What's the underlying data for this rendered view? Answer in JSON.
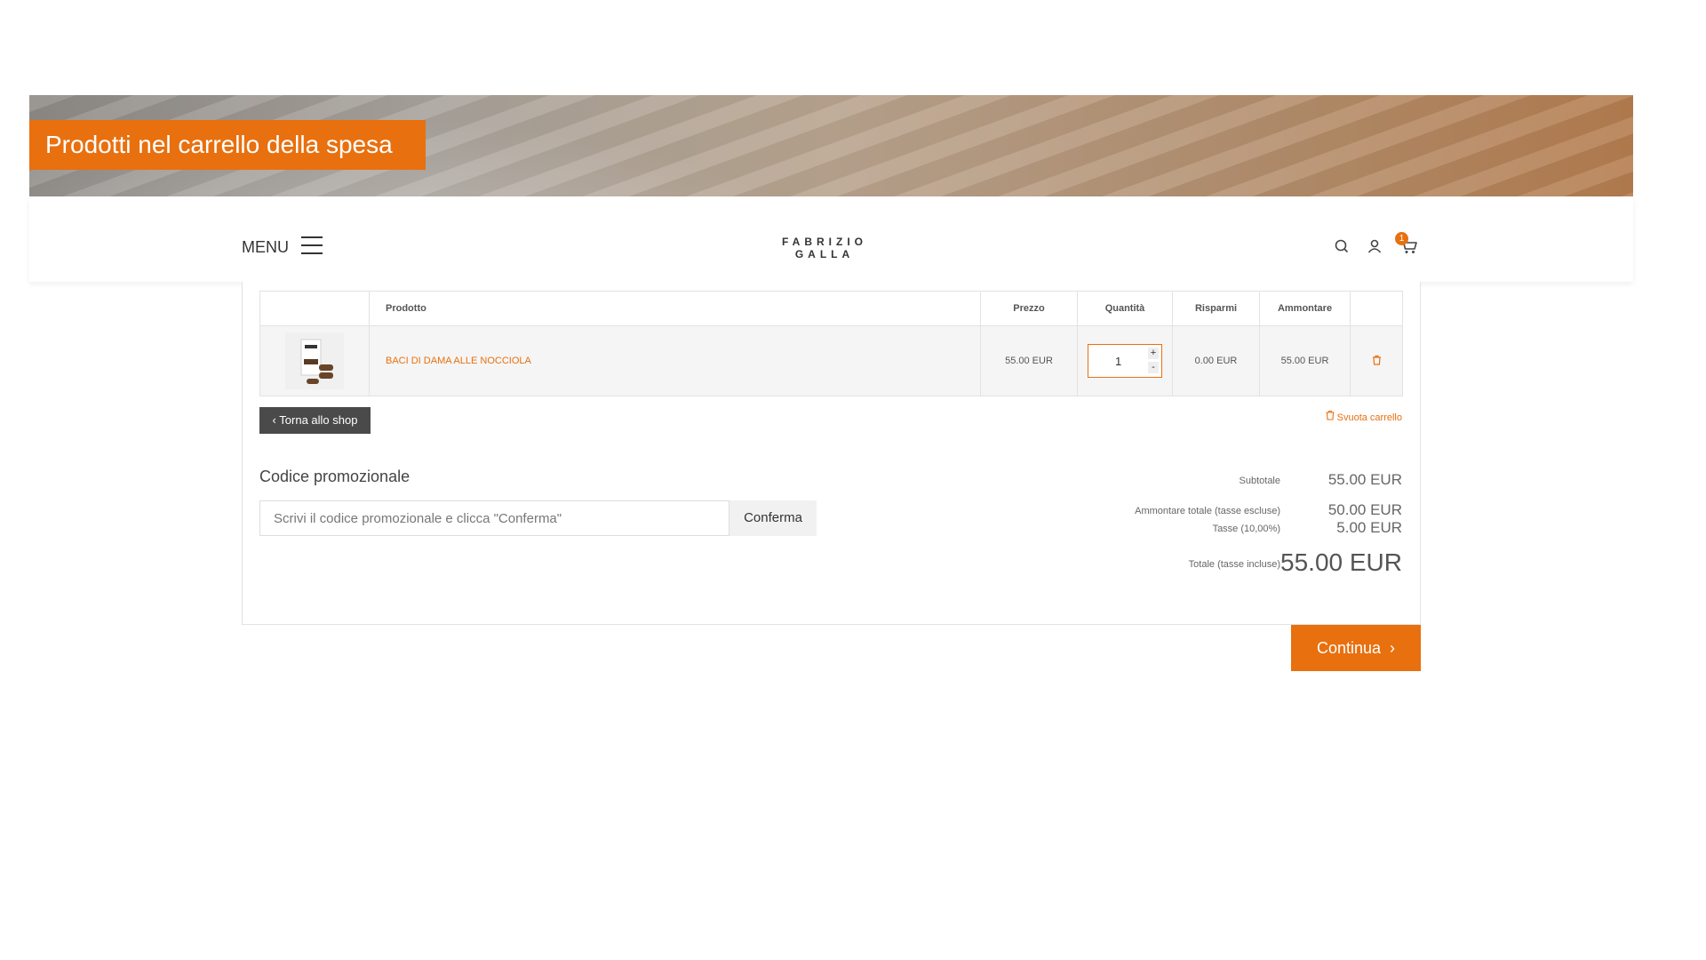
{
  "banner": {
    "title": "Prodotti nel carrello della spesa"
  },
  "header": {
    "menu_label": "MENU",
    "logo_line1": "FABRIZIO",
    "logo_line2": "GALLA",
    "cart_count": "1",
    "icons": [
      "search-icon",
      "user-icon",
      "cart-icon"
    ]
  },
  "cart": {
    "columns": {
      "product": "Prodotto",
      "price": "Prezzo",
      "quantity": "Quantità",
      "savings": "Risparmi",
      "amount": "Ammontare"
    },
    "items": [
      {
        "name": "BACI DI DAMA ALLE NOCCIOLA",
        "price": "55.00 EUR",
        "quantity": "1",
        "savings": "0.00 EUR",
        "amount": "55.00 EUR"
      }
    ],
    "back_label": "Torna allo shop",
    "empty_label": "Svuota carrello"
  },
  "promo": {
    "title": "Codice promozionale",
    "placeholder": "Scrivi il codice promozionale e clicca \"Conferma\"",
    "button": "Conferma"
  },
  "summary": {
    "subtotal_label": "Subtotale",
    "subtotal_value": "55.00 EUR",
    "net_label": "Ammontare totale (tasse escluse)",
    "net_value": "50.00 EUR",
    "tax_label": "Tasse (10,00%)",
    "tax_value": "5.00 EUR",
    "total_label": "Totale (tasse incluse)",
    "total_value": "55.00 EUR"
  },
  "continue_label": "Continua",
  "colors": {
    "accent": "#e8700f",
    "dark_button": "#4a4a4a"
  }
}
